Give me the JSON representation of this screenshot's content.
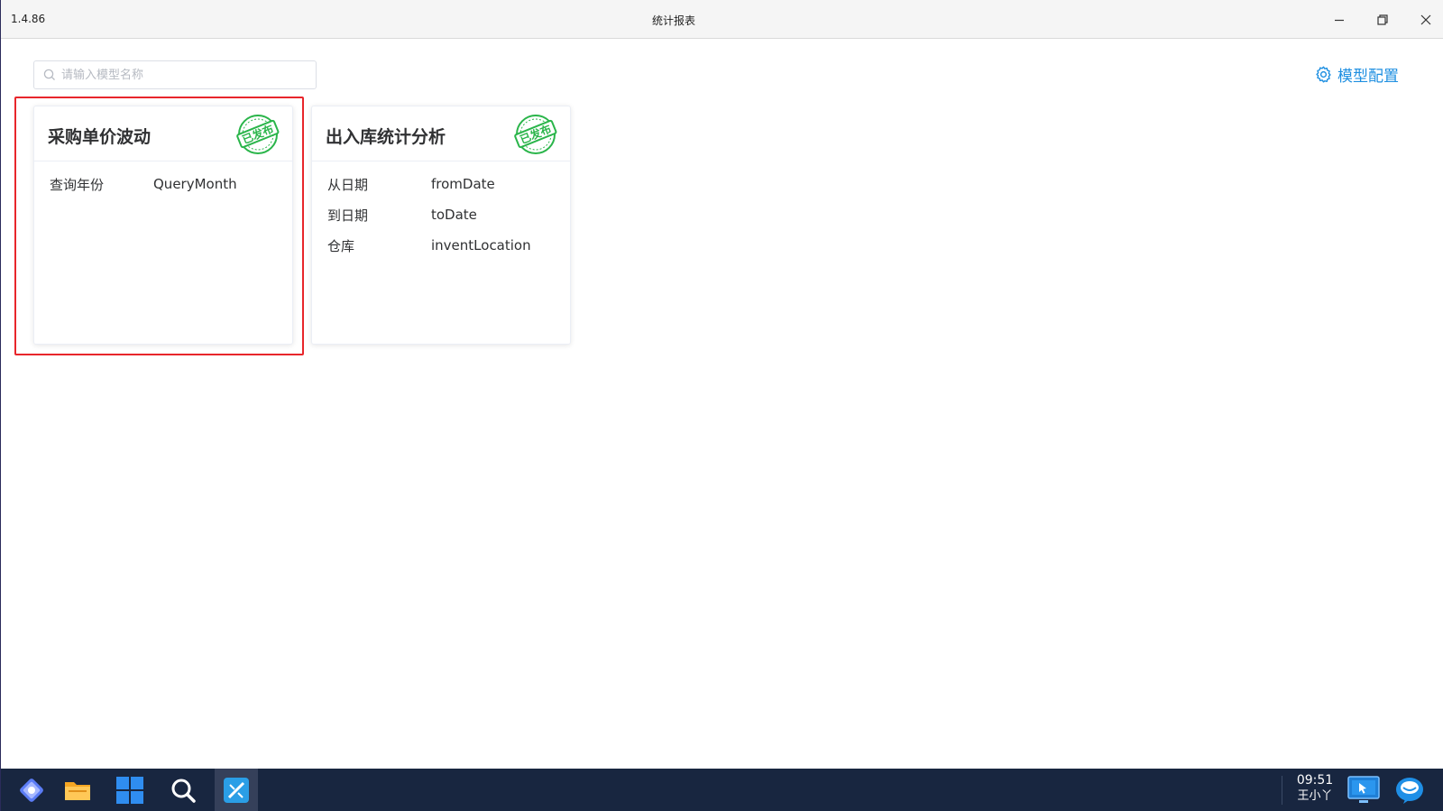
{
  "window": {
    "version": "1.4.86",
    "title": "统计报表"
  },
  "search": {
    "placeholder": "请输入模型名称",
    "value": ""
  },
  "toolbar": {
    "config_label": "模型配置"
  },
  "cards": [
    {
      "title": "采购单价波动",
      "status": "已发布",
      "params": [
        {
          "label": "查询年份",
          "value": "QueryMonth"
        }
      ]
    },
    {
      "title": "出入库统计分析",
      "status": "已发布",
      "params": [
        {
          "label": "从日期",
          "value": "fromDate"
        },
        {
          "label": "到日期",
          "value": "toDate"
        },
        {
          "label": "仓库",
          "value": "inventLocation"
        }
      ]
    }
  ],
  "taskbar": {
    "clock_time": "09:51",
    "user": "王小丫"
  },
  "colors": {
    "accent": "#1e8fe1",
    "stamp": "#2ab54a",
    "highlight": "#e8262b",
    "taskbar": "#182640"
  }
}
